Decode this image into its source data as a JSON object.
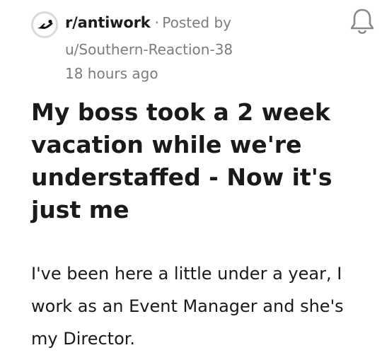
{
  "post": {
    "subreddit": "r/antiwork",
    "separator": "·",
    "posted_by_label": "Posted by",
    "username": "u/Southern-Reaction-38",
    "time_ago": "18 hours ago",
    "title": "My boss took a 2 week vacation while we're understaffed - Now it's just me",
    "body": "I've been here a little under a year, I work as an Event Manager and she's my Director."
  },
  "icons": {
    "subreddit_avatar": "subreddit-avatar-icon",
    "notifications": "bell-icon"
  }
}
